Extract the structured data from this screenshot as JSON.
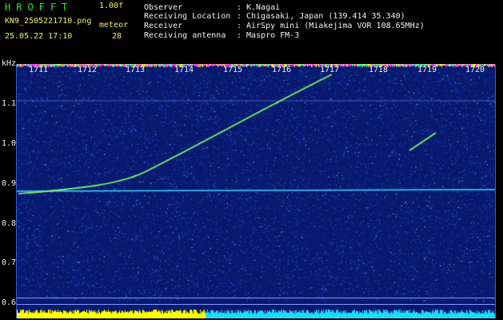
{
  "header": {
    "title": "HROFFT",
    "version": "1.00f",
    "filename": "KN9_2505221710.png",
    "meteor_label": "meteor",
    "datetime": "25.05.22 17:10",
    "meteor_count": "28"
  },
  "info": [
    {
      "label": "Observer",
      "value": "K.Nagai"
    },
    {
      "label": "Receiving Location",
      "value": "Chigasaki, Japan (139.414 35.340)"
    },
    {
      "label": "Receiver",
      "value": "AirSpy mini (Miakejima VOR 108.65MHz)"
    },
    {
      "label": "Receiving antenna",
      "value": "Maspro FM-3"
    }
  ],
  "y_axis": {
    "unit": "kHz",
    "ticks": [
      "1.1",
      "1.0",
      "0.9",
      "0.8",
      "0.7",
      "0.6"
    ]
  },
  "x_axis": {
    "ticks": [
      "1711",
      "1712",
      "1713",
      "1714",
      "1715",
      "1716",
      "1717",
      "1718",
      "1719",
      "1720"
    ]
  },
  "colors": {
    "background": "#081a6e",
    "header_green": "#2fe62f",
    "header_yellow": "#f2f25a",
    "signal_green": "#7dff6a",
    "carrier_cyan": "#41d6ff",
    "bar_yellow": "#ffff00",
    "bar_cyan": "#20d8ff"
  }
}
